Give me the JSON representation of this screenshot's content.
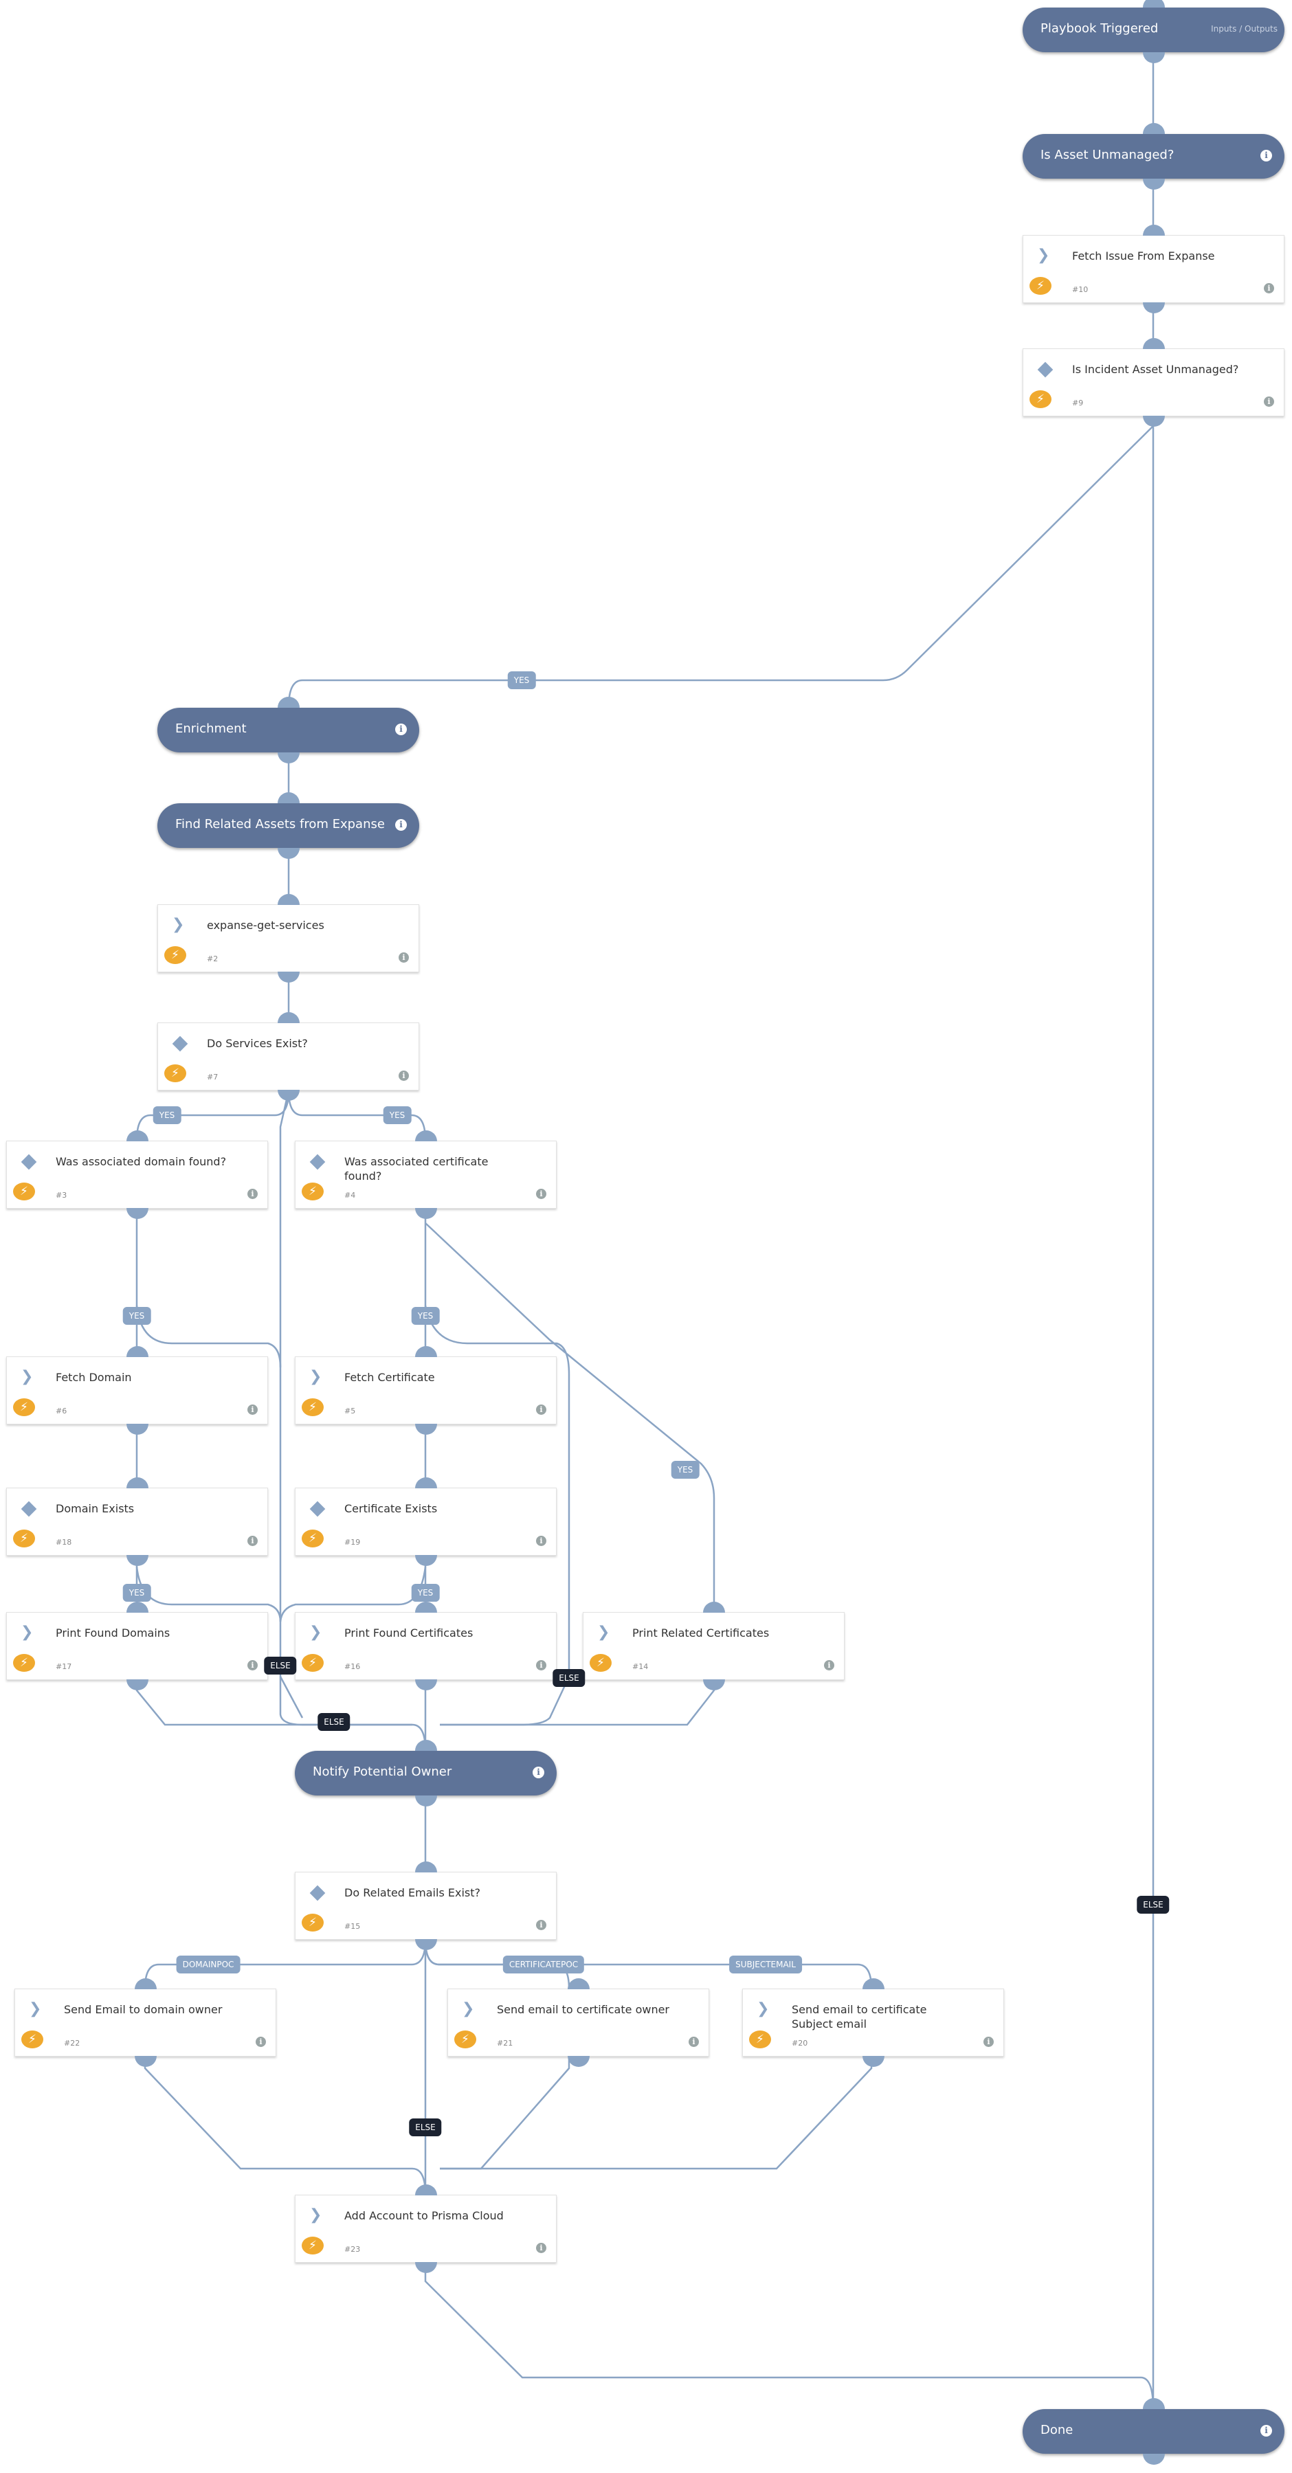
{
  "colors": {
    "header": "#5e7398",
    "edge": "#8aa4c4",
    "else": "#1b2230",
    "automation": "#f0a92e"
  },
  "nodes": [
    {
      "kind": "header",
      "title": "Playbook Triggered",
      "extra": "Inputs / Outputs"
    },
    {
      "kind": "header",
      "title": "Is Asset Unmanaged?",
      "info": "i"
    },
    {
      "kind": "task",
      "icon": "chevron",
      "title": "Fetch Issue From Expanse",
      "num": "#10",
      "info": "i"
    },
    {
      "kind": "condition",
      "icon": "diamond",
      "title": "Is Incident Asset Unmanaged?",
      "num": "#9",
      "info": "i"
    },
    {
      "kind": "header",
      "title": "Enrichment",
      "info": "i"
    },
    {
      "kind": "header",
      "title": "Find Related Assets from Expanse",
      "info": "i"
    },
    {
      "kind": "task",
      "icon": "chevron",
      "title": "expanse-get-services",
      "num": "#2",
      "info": "i"
    },
    {
      "kind": "condition",
      "icon": "diamond",
      "title": "Do Services Exist?",
      "num": "#7",
      "info": "i"
    },
    {
      "kind": "condition",
      "icon": "diamond",
      "title": "Was associated domain found?",
      "num": "#3",
      "info": "i"
    },
    {
      "kind": "condition",
      "icon": "diamond",
      "title": "Was associated certificate found?",
      "num": "#4",
      "info": "i"
    },
    {
      "kind": "task",
      "icon": "chevron",
      "title": "Fetch Domain",
      "num": "#6",
      "info": "i"
    },
    {
      "kind": "task",
      "icon": "chevron",
      "title": "Fetch Certificate",
      "num": "#5",
      "info": "i"
    },
    {
      "kind": "condition",
      "icon": "diamond",
      "title": "Domain Exists",
      "num": "#18",
      "info": "i"
    },
    {
      "kind": "condition",
      "icon": "diamond",
      "title": "Certificate Exists",
      "num": "#19",
      "info": "i"
    },
    {
      "kind": "task",
      "icon": "chevron",
      "title": "Print Found Domains",
      "num": "#17",
      "info": "i"
    },
    {
      "kind": "task",
      "icon": "chevron",
      "title": "Print Found Certificates",
      "num": "#16",
      "info": "i"
    },
    {
      "kind": "task",
      "icon": "chevron",
      "title": "Print Related Certificates",
      "num": "#14",
      "info": "i"
    },
    {
      "kind": "header",
      "title": "Notify Potential Owner",
      "info": "i"
    },
    {
      "kind": "condition",
      "icon": "diamond",
      "title": "Do Related Emails Exist?",
      "num": "#15",
      "info": "i"
    },
    {
      "kind": "task",
      "icon": "chevron",
      "title": "Send Email to domain owner",
      "num": "#22",
      "info": "i"
    },
    {
      "kind": "task",
      "icon": "chevron",
      "title": "Send email to certificate owner",
      "num": "#21",
      "info": "i"
    },
    {
      "kind": "task",
      "icon": "chevron",
      "title": "Send email to certificate Subject email",
      "num": "#20",
      "info": "i"
    },
    {
      "kind": "task",
      "icon": "chevron",
      "title": "Add Account to Prisma Cloud",
      "num": "#23",
      "info": "i"
    },
    {
      "kind": "header",
      "title": "Done",
      "info": "i"
    }
  ],
  "labels": [
    {
      "text": "YES",
      "type": "yes"
    },
    {
      "text": "YES",
      "type": "yes"
    },
    {
      "text": "YES",
      "type": "yes"
    },
    {
      "text": "YES",
      "type": "yes"
    },
    {
      "text": "YES",
      "type": "yes"
    },
    {
      "text": "YES",
      "type": "yes"
    },
    {
      "text": "YES",
      "type": "yes"
    },
    {
      "text": "YES",
      "type": "yes"
    },
    {
      "text": "ELSE",
      "type": "else"
    },
    {
      "text": "ELSE",
      "type": "else"
    },
    {
      "text": "ELSE",
      "type": "else"
    },
    {
      "text": "ELSE",
      "type": "else"
    },
    {
      "text": "DOMAINPOC",
      "type": "yes"
    },
    {
      "text": "CERTIFICATEPOC",
      "type": "yes"
    },
    {
      "text": "SUBJECTEMAIL",
      "type": "yes"
    },
    {
      "text": "ELSE",
      "type": "else"
    }
  ]
}
